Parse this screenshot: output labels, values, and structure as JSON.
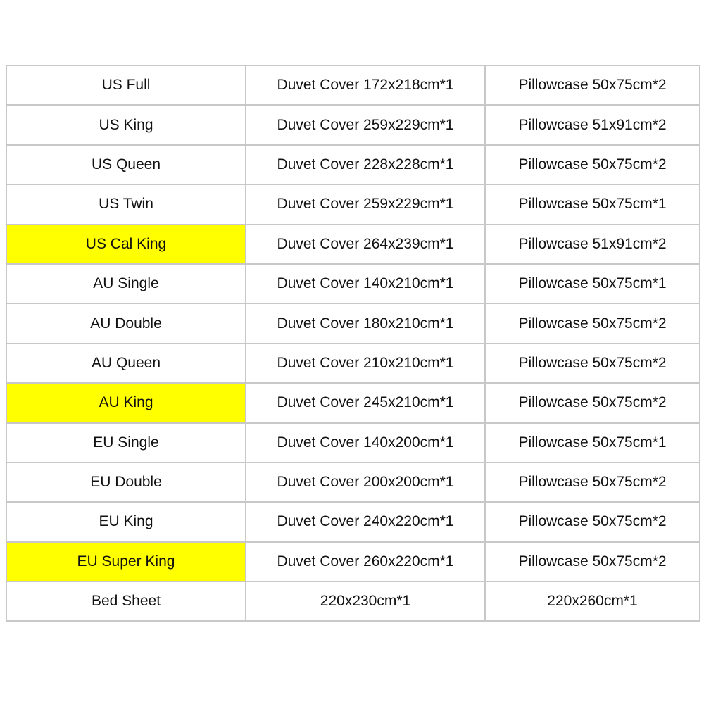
{
  "highlight_color": "#ffff00",
  "rows": [
    {
      "size": "US Full",
      "duvet": "Duvet Cover 172x218cm*1",
      "pillow": "Pillowcase 50x75cm*2",
      "highlighted": false
    },
    {
      "size": "US King",
      "duvet": "Duvet Cover 259x229cm*1",
      "pillow": "Pillowcase 51x91cm*2",
      "highlighted": false
    },
    {
      "size": "US Queen",
      "duvet": "Duvet Cover 228x228cm*1",
      "pillow": "Pillowcase 50x75cm*2",
      "highlighted": false
    },
    {
      "size": "US Twin",
      "duvet": "Duvet Cover 259x229cm*1",
      "pillow": "Pillowcase 50x75cm*1",
      "highlighted": false
    },
    {
      "size": "US Cal King",
      "duvet": "Duvet Cover 264x239cm*1",
      "pillow": "Pillowcase 51x91cm*2",
      "highlighted": true
    },
    {
      "size": "AU Single",
      "duvet": "Duvet Cover 140x210cm*1",
      "pillow": "Pillowcase 50x75cm*1",
      "highlighted": false
    },
    {
      "size": "AU Double",
      "duvet": "Duvet Cover 180x210cm*1",
      "pillow": "Pillowcase 50x75cm*2",
      "highlighted": false
    },
    {
      "size": "AU Queen",
      "duvet": "Duvet Cover 210x210cm*1",
      "pillow": "Pillowcase 50x75cm*2",
      "highlighted": false
    },
    {
      "size": "AU King",
      "duvet": "Duvet Cover 245x210cm*1",
      "pillow": "Pillowcase 50x75cm*2",
      "highlighted": true
    },
    {
      "size": "EU Single",
      "duvet": "Duvet Cover 140x200cm*1",
      "pillow": "Pillowcase 50x75cm*1",
      "highlighted": false
    },
    {
      "size": "EU Double",
      "duvet": "Duvet Cover 200x200cm*1",
      "pillow": "Pillowcase 50x75cm*2",
      "highlighted": false
    },
    {
      "size": "EU King",
      "duvet": "Duvet Cover 240x220cm*1",
      "pillow": "Pillowcase 50x75cm*2",
      "highlighted": false
    },
    {
      "size": "EU Super King",
      "duvet": "Duvet Cover 260x220cm*1",
      "pillow": "Pillowcase 50x75cm*2",
      "highlighted": true
    },
    {
      "size": "Bed Sheet",
      "duvet": "220x230cm*1",
      "pillow": "220x260cm*1",
      "highlighted": false
    }
  ]
}
